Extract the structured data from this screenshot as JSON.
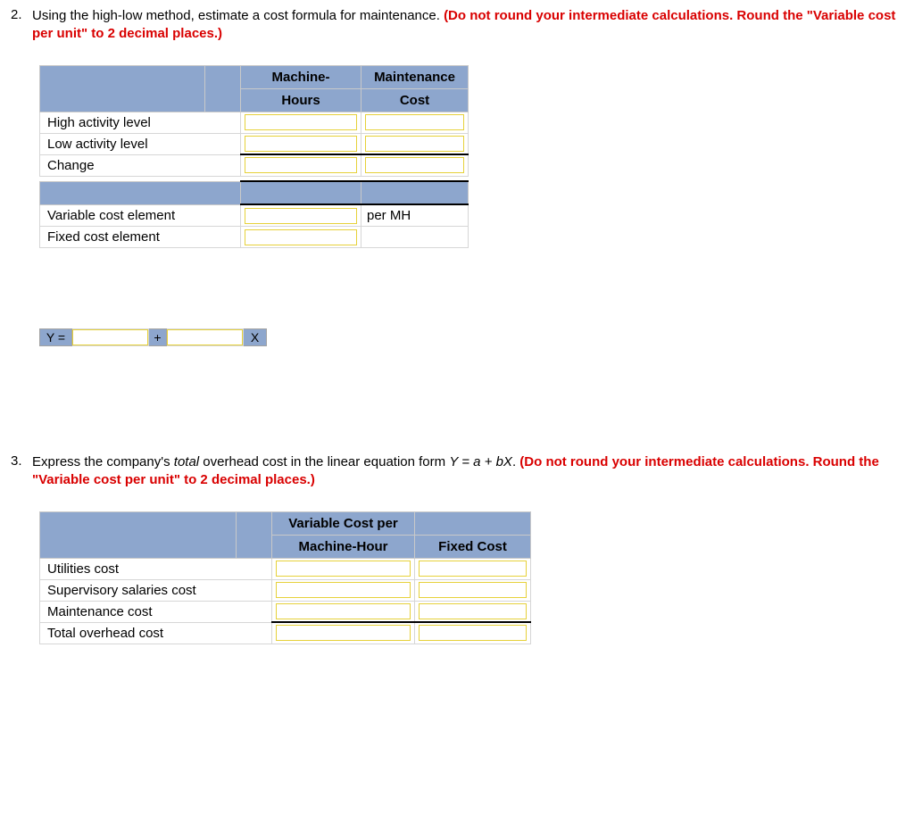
{
  "q2": {
    "number": "2.",
    "text_plain": "Using the high-low method, estimate a cost formula for maintenance. ",
    "text_instr": "(Do not round your intermediate calculations. Round the \"Variable cost per unit\" to 2 decimal places.)",
    "table1": {
      "h1": "Machine-",
      "h1b": "Hours",
      "h2": "Maintenance",
      "h2b": "Cost",
      "r1": "High activity level",
      "r2": "Low activity level",
      "r3": "Change",
      "r4": "Variable cost element",
      "r4_unit": "per MH",
      "r5": "Fixed cost element"
    },
    "equation": {
      "y": "Y =",
      "plus": "+",
      "x": "X"
    }
  },
  "q3": {
    "number": "3.",
    "text_pre": "Express the company's ",
    "text_italic": "total",
    "text_mid": " overhead cost in the linear equation form ",
    "text_formula": "Y = a + bX",
    "text_post": ". ",
    "text_instr": "(Do not round your intermediate calculations. Round the \"Variable cost per unit\" to 2 decimal places.)",
    "table": {
      "h1a": "Variable Cost per",
      "h1b": "Machine-Hour",
      "h2": "Fixed Cost",
      "r1": "Utilities cost",
      "r2": "Supervisory salaries cost",
      "r3": "Maintenance cost",
      "r4": "Total overhead cost"
    }
  }
}
